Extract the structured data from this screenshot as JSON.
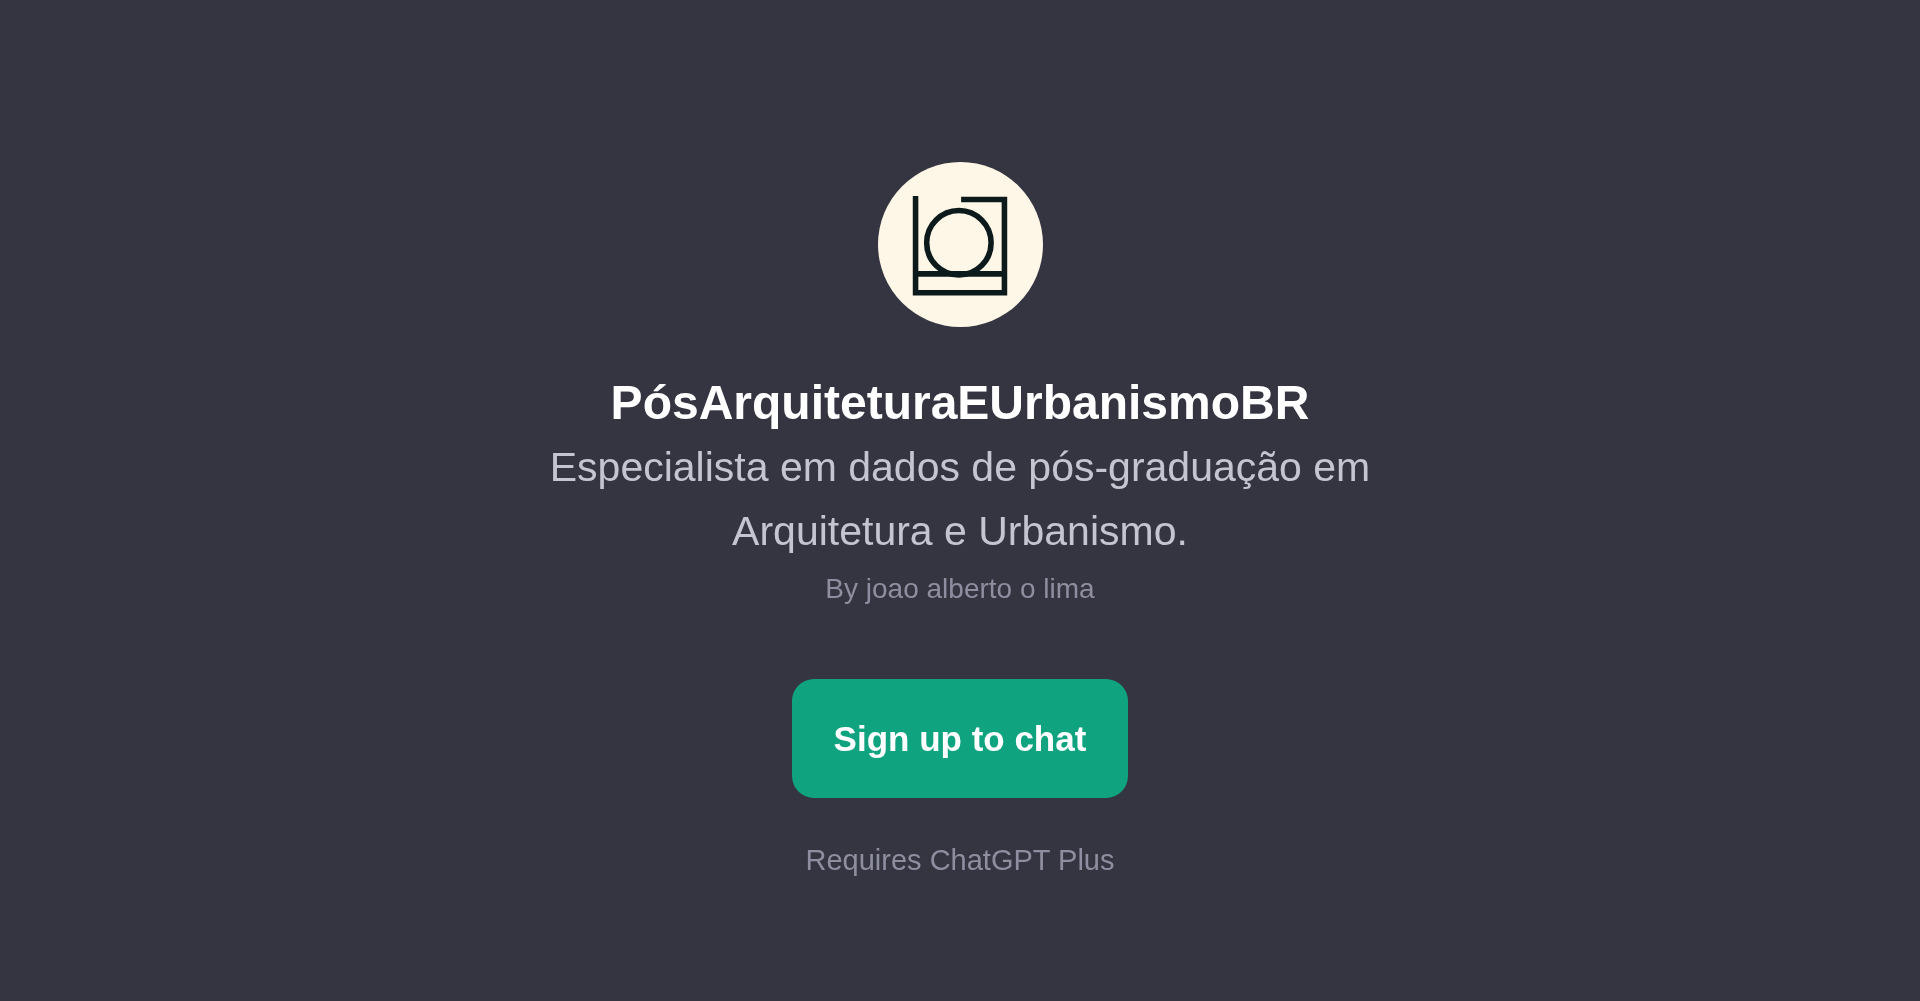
{
  "title": "PósArquiteturaEUrbanismoBR",
  "description": "Especialista em dados de pós-graduação em Arquitetura e Urbanismo.",
  "author": "By joao alberto o lima",
  "button": "Sign up to chat",
  "note": "Requires ChatGPT Plus"
}
